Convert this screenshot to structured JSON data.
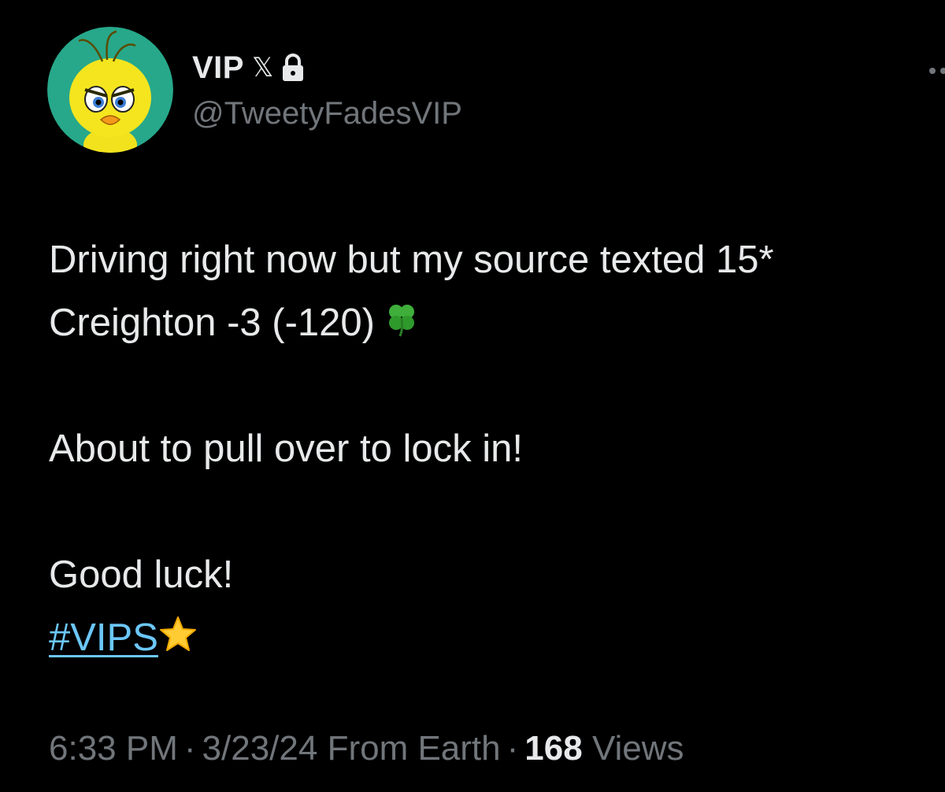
{
  "author": {
    "display_name": "VIP",
    "badge_glyph": "𝕏",
    "handle": "@TweetyFadesVIP",
    "avatar_icon": "tweety-bird-avatar",
    "avatar_bg": "#27a88a"
  },
  "tweet": {
    "line1": "Driving right now but my source texted 15*",
    "line2": "Creighton -3 (-120)",
    "line2_emoji": "four-leaf-clover-icon",
    "line3": "About to pull over to lock in!",
    "line4": "Good luck!",
    "hashtag": "#VIPS",
    "hashtag_emoji": "star-icon"
  },
  "meta": {
    "time": "6:33 PM",
    "separator": "·",
    "date": "3/23/24",
    "source": "From Earth",
    "views_count": "168",
    "views_label": "Views"
  },
  "colors": {
    "background": "#000000",
    "text": "#e7e9ea",
    "muted": "#71767b",
    "link": "#6cc7f9"
  }
}
